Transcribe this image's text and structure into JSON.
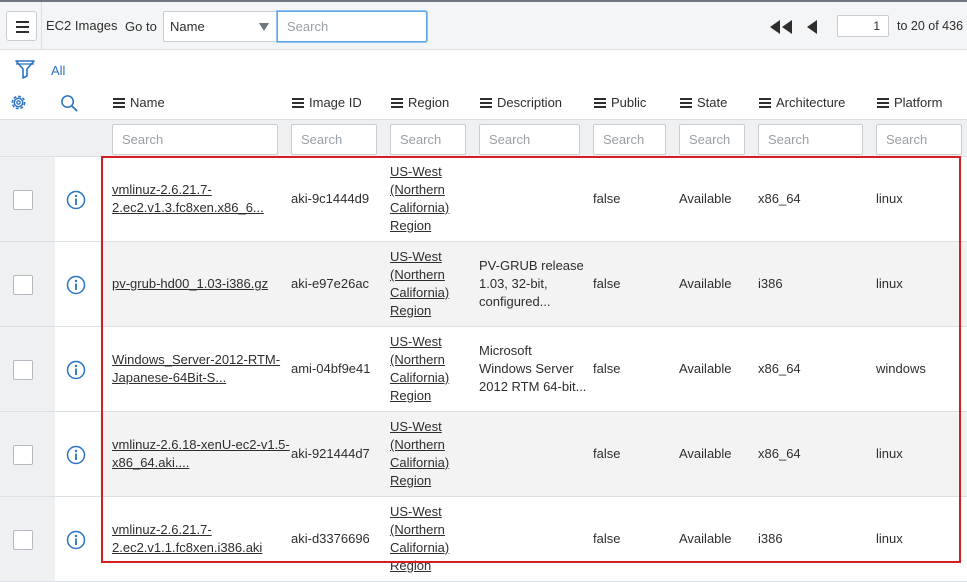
{
  "header": {
    "title": "EC2 Images",
    "goto_label": "Go to",
    "goto_field": "Name",
    "search_placeholder": "Search",
    "page_input": "1",
    "page_total": "to 20 of 436"
  },
  "filter": {
    "all_label": "All"
  },
  "columns": [
    {
      "label": "Name"
    },
    {
      "label": "Image ID"
    },
    {
      "label": "Region"
    },
    {
      "label": "Description"
    },
    {
      "label": "Public"
    },
    {
      "label": "State"
    },
    {
      "label": "Architecture"
    },
    {
      "label": "Platform"
    }
  ],
  "column_search_placeholder": "Search",
  "rows": [
    {
      "name_l1": "vmlinuz-2.6.21.7-",
      "name_l2": "2.ec2.v1.3.fc8xen.x86_6...",
      "image_id": "aki-9c1444d9",
      "region_l1": "US-West",
      "region_l2": "(Northern",
      "region_l3": "California)",
      "region_l4": "Region",
      "desc_l1": "",
      "desc_l2": "",
      "desc_l3": "",
      "public": "false",
      "state": "Available",
      "arch": "x86_64",
      "platform": "linux"
    },
    {
      "name_l1": "pv-grub-hd00_1.03-i386.gz",
      "name_l2": "",
      "image_id": "aki-e97e26ac",
      "region_l1": "US-West",
      "region_l2": "(Northern",
      "region_l3": "California)",
      "region_l4": "Region",
      "desc_l1": "PV-GRUB release",
      "desc_l2": "1.03, 32-bit,",
      "desc_l3": "configured...",
      "public": "false",
      "state": "Available",
      "arch": "i386",
      "platform": "linux"
    },
    {
      "name_l1": "Windows_Server-2012-RTM-",
      "name_l2": "Japanese-64Bit-S...",
      "image_id": "ami-04bf9e41",
      "region_l1": "US-West",
      "region_l2": "(Northern",
      "region_l3": "California)",
      "region_l4": "Region",
      "desc_l1": "Microsoft",
      "desc_l2": "Windows Server",
      "desc_l3": "2012 RTM 64-bit...",
      "public": "false",
      "state": "Available",
      "arch": "x86_64",
      "platform": "windows"
    },
    {
      "name_l1": "vmlinuz-2.6.18-xenU-ec2-v1.5-",
      "name_l2": "x86_64.aki....",
      "image_id": "aki-921444d7",
      "region_l1": "US-West",
      "region_l2": "(Northern",
      "region_l3": "California)",
      "region_l4": "Region",
      "desc_l1": "",
      "desc_l2": "",
      "desc_l3": "",
      "public": "false",
      "state": "Available",
      "arch": "x86_64",
      "platform": "linux"
    },
    {
      "name_l1": "vmlinuz-2.6.21.7-",
      "name_l2": "2.ec2.v1.1.fc8xen.i386.aki",
      "image_id": "aki-d3376696",
      "region_l1": "US-West",
      "region_l2": "(Northern",
      "region_l3": "California)",
      "region_l4": "Region",
      "desc_l1": "",
      "desc_l2": "",
      "desc_l3": "",
      "public": "false",
      "state": "Available",
      "arch": "i386",
      "platform": "linux"
    }
  ],
  "colors": {
    "accent": "#2b73c6",
    "highlight": "#d41e23",
    "focus": "#5ea7e6"
  }
}
